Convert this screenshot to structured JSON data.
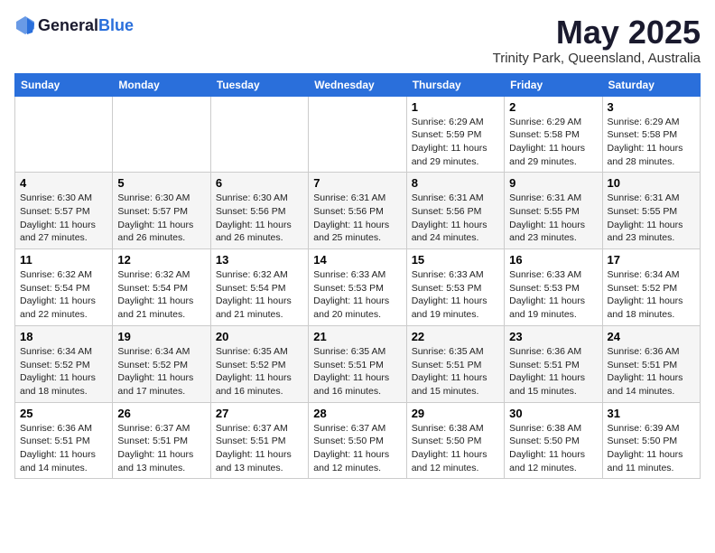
{
  "header": {
    "logo_general": "General",
    "logo_blue": "Blue",
    "month_year": "May 2025",
    "location": "Trinity Park, Queensland, Australia"
  },
  "weekdays": [
    "Sunday",
    "Monday",
    "Tuesday",
    "Wednesday",
    "Thursday",
    "Friday",
    "Saturday"
  ],
  "weeks": [
    [
      {
        "day": "",
        "info": ""
      },
      {
        "day": "",
        "info": ""
      },
      {
        "day": "",
        "info": ""
      },
      {
        "day": "",
        "info": ""
      },
      {
        "day": "1",
        "info": "Sunrise: 6:29 AM\nSunset: 5:59 PM\nDaylight: 11 hours and 29 minutes."
      },
      {
        "day": "2",
        "info": "Sunrise: 6:29 AM\nSunset: 5:58 PM\nDaylight: 11 hours and 29 minutes."
      },
      {
        "day": "3",
        "info": "Sunrise: 6:29 AM\nSunset: 5:58 PM\nDaylight: 11 hours and 28 minutes."
      }
    ],
    [
      {
        "day": "4",
        "info": "Sunrise: 6:30 AM\nSunset: 5:57 PM\nDaylight: 11 hours and 27 minutes."
      },
      {
        "day": "5",
        "info": "Sunrise: 6:30 AM\nSunset: 5:57 PM\nDaylight: 11 hours and 26 minutes."
      },
      {
        "day": "6",
        "info": "Sunrise: 6:30 AM\nSunset: 5:56 PM\nDaylight: 11 hours and 26 minutes."
      },
      {
        "day": "7",
        "info": "Sunrise: 6:31 AM\nSunset: 5:56 PM\nDaylight: 11 hours and 25 minutes."
      },
      {
        "day": "8",
        "info": "Sunrise: 6:31 AM\nSunset: 5:56 PM\nDaylight: 11 hours and 24 minutes."
      },
      {
        "day": "9",
        "info": "Sunrise: 6:31 AM\nSunset: 5:55 PM\nDaylight: 11 hours and 23 minutes."
      },
      {
        "day": "10",
        "info": "Sunrise: 6:31 AM\nSunset: 5:55 PM\nDaylight: 11 hours and 23 minutes."
      }
    ],
    [
      {
        "day": "11",
        "info": "Sunrise: 6:32 AM\nSunset: 5:54 PM\nDaylight: 11 hours and 22 minutes."
      },
      {
        "day": "12",
        "info": "Sunrise: 6:32 AM\nSunset: 5:54 PM\nDaylight: 11 hours and 21 minutes."
      },
      {
        "day": "13",
        "info": "Sunrise: 6:32 AM\nSunset: 5:54 PM\nDaylight: 11 hours and 21 minutes."
      },
      {
        "day": "14",
        "info": "Sunrise: 6:33 AM\nSunset: 5:53 PM\nDaylight: 11 hours and 20 minutes."
      },
      {
        "day": "15",
        "info": "Sunrise: 6:33 AM\nSunset: 5:53 PM\nDaylight: 11 hours and 19 minutes."
      },
      {
        "day": "16",
        "info": "Sunrise: 6:33 AM\nSunset: 5:53 PM\nDaylight: 11 hours and 19 minutes."
      },
      {
        "day": "17",
        "info": "Sunrise: 6:34 AM\nSunset: 5:52 PM\nDaylight: 11 hours and 18 minutes."
      }
    ],
    [
      {
        "day": "18",
        "info": "Sunrise: 6:34 AM\nSunset: 5:52 PM\nDaylight: 11 hours and 18 minutes."
      },
      {
        "day": "19",
        "info": "Sunrise: 6:34 AM\nSunset: 5:52 PM\nDaylight: 11 hours and 17 minutes."
      },
      {
        "day": "20",
        "info": "Sunrise: 6:35 AM\nSunset: 5:52 PM\nDaylight: 11 hours and 16 minutes."
      },
      {
        "day": "21",
        "info": "Sunrise: 6:35 AM\nSunset: 5:51 PM\nDaylight: 11 hours and 16 minutes."
      },
      {
        "day": "22",
        "info": "Sunrise: 6:35 AM\nSunset: 5:51 PM\nDaylight: 11 hours and 15 minutes."
      },
      {
        "day": "23",
        "info": "Sunrise: 6:36 AM\nSunset: 5:51 PM\nDaylight: 11 hours and 15 minutes."
      },
      {
        "day": "24",
        "info": "Sunrise: 6:36 AM\nSunset: 5:51 PM\nDaylight: 11 hours and 14 minutes."
      }
    ],
    [
      {
        "day": "25",
        "info": "Sunrise: 6:36 AM\nSunset: 5:51 PM\nDaylight: 11 hours and 14 minutes."
      },
      {
        "day": "26",
        "info": "Sunrise: 6:37 AM\nSunset: 5:51 PM\nDaylight: 11 hours and 13 minutes."
      },
      {
        "day": "27",
        "info": "Sunrise: 6:37 AM\nSunset: 5:51 PM\nDaylight: 11 hours and 13 minutes."
      },
      {
        "day": "28",
        "info": "Sunrise: 6:37 AM\nSunset: 5:50 PM\nDaylight: 11 hours and 12 minutes."
      },
      {
        "day": "29",
        "info": "Sunrise: 6:38 AM\nSunset: 5:50 PM\nDaylight: 11 hours and 12 minutes."
      },
      {
        "day": "30",
        "info": "Sunrise: 6:38 AM\nSunset: 5:50 PM\nDaylight: 11 hours and 12 minutes."
      },
      {
        "day": "31",
        "info": "Sunrise: 6:39 AM\nSunset: 5:50 PM\nDaylight: 11 hours and 11 minutes."
      }
    ]
  ]
}
